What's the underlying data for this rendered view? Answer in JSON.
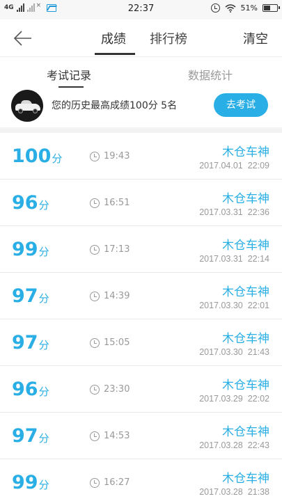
{
  "status_bar": {
    "network": "4G",
    "time": "22:37",
    "battery": "51%"
  },
  "header": {
    "tabs": [
      "成绩",
      "排行榜"
    ],
    "active_tab": "成绩",
    "clear_label": "清空"
  },
  "subtabs": {
    "records": "考试记录",
    "stats": "数据统计",
    "active": "考试记录"
  },
  "best": {
    "text": "您的历史最高成绩100分  5名",
    "button": "去考试"
  },
  "records": [
    {
      "score": "100",
      "unit": "分",
      "duration": "19:43",
      "name": "木仓车神",
      "date": "2017.04.01  22:09"
    },
    {
      "score": "96",
      "unit": "分",
      "duration": "16:51",
      "name": "木仓车神",
      "date": "2017.03.31  22:36"
    },
    {
      "score": "99",
      "unit": "分",
      "duration": "17:13",
      "name": "木仓车神",
      "date": "2017.03.31  22:14"
    },
    {
      "score": "97",
      "unit": "分",
      "duration": "14:39",
      "name": "木仓车神",
      "date": "2017.03.30  22:01"
    },
    {
      "score": "97",
      "unit": "分",
      "duration": "15:05",
      "name": "木仓车神",
      "date": "2017.03.30  21:43"
    },
    {
      "score": "96",
      "unit": "分",
      "duration": "23:30",
      "name": "木仓车神",
      "date": "2017.03.29  22:02"
    },
    {
      "score": "97",
      "unit": "分",
      "duration": "14:53",
      "name": "木仓车神",
      "date": "2017.03.28  22:43"
    },
    {
      "score": "99",
      "unit": "分",
      "duration": "16:27",
      "name": "木仓车神",
      "date": "2017.03.28  21:38"
    }
  ],
  "colors": {
    "accent": "#29aee5",
    "muted": "#999999"
  },
  "icons": {
    "back": "arrow-left-icon",
    "clock": "clock-icon"
  }
}
